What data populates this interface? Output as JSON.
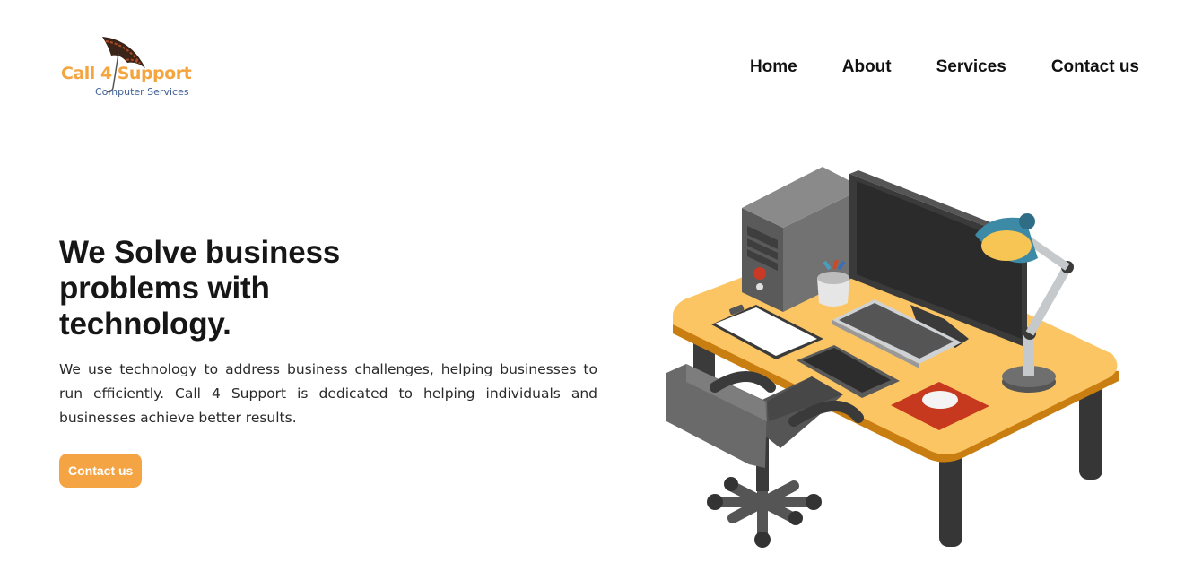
{
  "brand": {
    "name": "Call 4 Support",
    "tagline": "Computer Services",
    "colors": {
      "accent": "#f5a444",
      "brand_blue": "#3e5f95"
    }
  },
  "nav": {
    "items": [
      {
        "label": "Home"
      },
      {
        "label": "About"
      },
      {
        "label": "Services"
      },
      {
        "label": "Contact us"
      }
    ]
  },
  "hero": {
    "title_line1": "We Solve business",
    "title_line2": "problems with",
    "title_line3": "technology.",
    "description": "We use technology to address business challenges, helping businesses to run efficiently. Call 4 Support is dedicated to helping individuals and businesses achieve better results.",
    "cta_label": "Contact us"
  },
  "illustration": {
    "icon": "office-desk-illustration",
    "parts": [
      "desktop-tower",
      "monitor",
      "desk-lamp",
      "keyboard",
      "clipboard",
      "tablet",
      "mouse",
      "pen-cup",
      "office-chair"
    ]
  }
}
